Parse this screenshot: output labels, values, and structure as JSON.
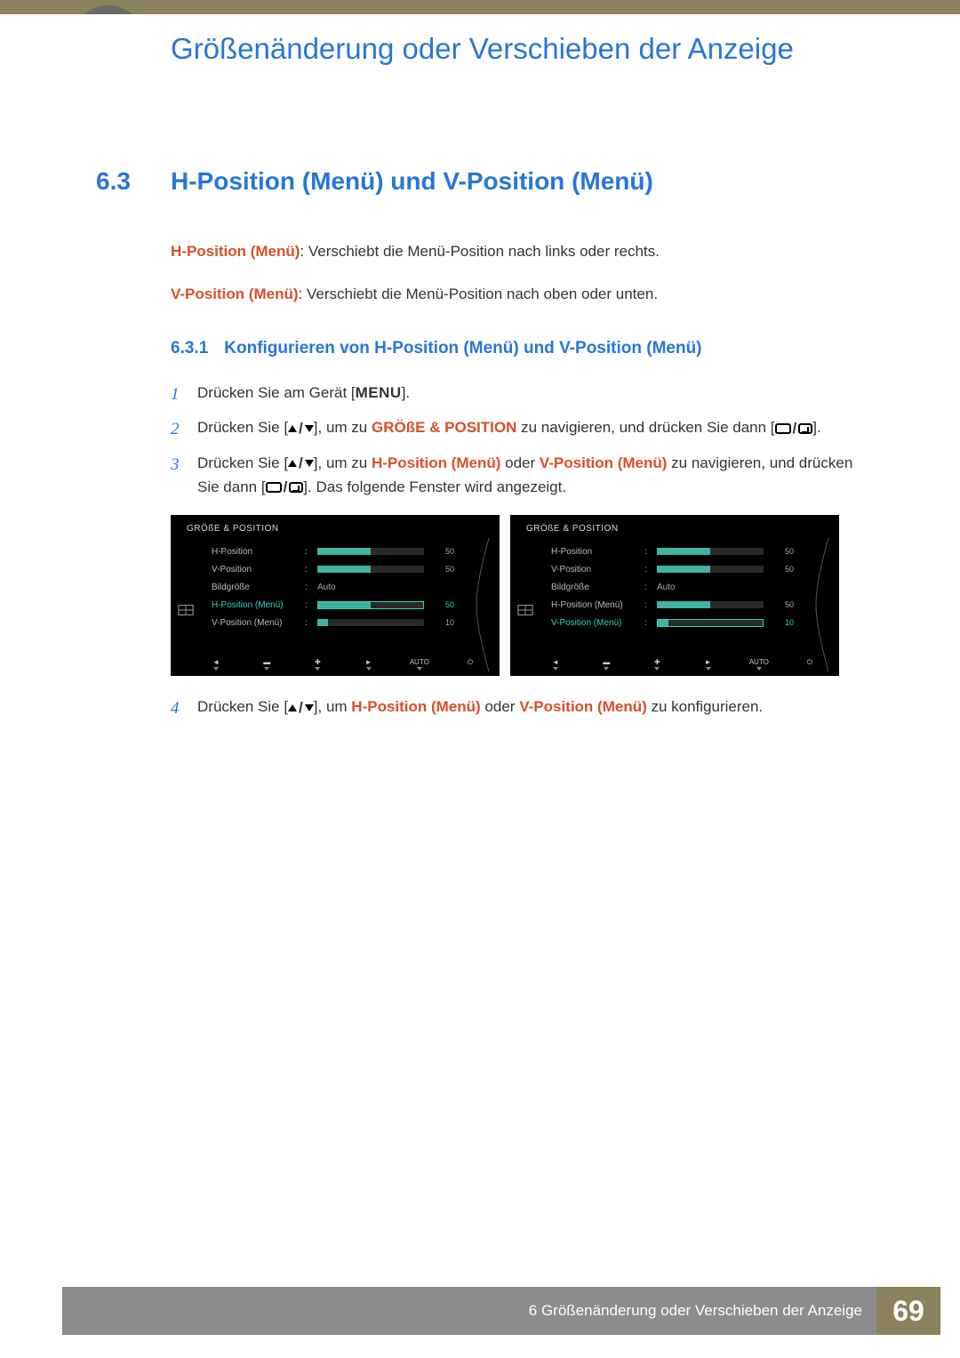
{
  "chapter_title": "Größenänderung oder Verschieben der Anzeige",
  "section": {
    "num": "6.3",
    "title": "H-Position (Menü) und V-Position (Menü)"
  },
  "para_h_label": "H-Position (Menü)",
  "para_h_text": ": Verschiebt die Menü-Position nach links oder rechts.",
  "para_v_label": "V-Position (Menü)",
  "para_v_text": ": Verschiebt die Menü-Position nach oben oder unten.",
  "subsection": {
    "num": "6.3.1",
    "title": "Konfigurieren von H-Position (Menü) und V-Position (Menü)"
  },
  "steps": {
    "s1": {
      "n": "1",
      "pre": "Drücken Sie am Gerät [",
      "menu": "MENU",
      "post": "]."
    },
    "s2": {
      "n": "2",
      "a": "Drücken Sie [",
      "b": "], um zu ",
      "target": "GRÖßE & POSITION",
      "c": " zu navigieren, und drücken Sie dann [",
      "d": "]."
    },
    "s3": {
      "n": "3",
      "a": "Drücken Sie [",
      "b": "], um zu ",
      "h": "H-Position (Menü)",
      "or": " oder ",
      "v": "V-Position (Menü)",
      "c": " zu navigieren, und drücken Sie dann [",
      "d": "]. Das folgende Fenster wird angezeigt."
    },
    "s4": {
      "n": "4",
      "a": "Drücken Sie [",
      "b": "], um ",
      "h": "H-Position (Menü)",
      "or": " oder ",
      "v": "V-Position (Menü)",
      "c": " zu konfigurieren."
    }
  },
  "osd": {
    "title": "GRÖßE & POSITION",
    "rows": [
      {
        "label": "H-Position",
        "val": "50",
        "fill": 50
      },
      {
        "label": "V-Position",
        "val": "50",
        "fill": 50
      },
      {
        "label": "Bildgröße",
        "text": "Auto"
      },
      {
        "label": "H-Position (Menü)",
        "val": "50",
        "fill": 50
      },
      {
        "label": "V-Position (Menü)",
        "val": "10",
        "fill": 10
      }
    ],
    "left_active_index": 3,
    "right_active_index": 4,
    "bottom_auto": "AUTO"
  },
  "footer": {
    "text": "6 Größenänderung oder Verschieben der Anzeige",
    "page": "69"
  }
}
